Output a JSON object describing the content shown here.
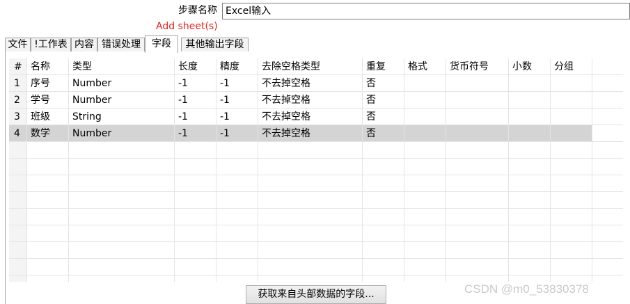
{
  "step": {
    "label": "步骤名称",
    "value": "Excel输入",
    "add_sheet": "Add sheet(s)"
  },
  "tabs": [
    {
      "label": "文件"
    },
    {
      "label": "!工作表"
    },
    {
      "label": "内容"
    },
    {
      "label": "错误处理"
    },
    {
      "label": "字段",
      "active": true
    },
    {
      "label": "其他输出字段"
    }
  ],
  "table": {
    "headers": [
      "#",
      "名称",
      "类型",
      "长度",
      "精度",
      "去除空格类型",
      "重复",
      "格式",
      "货币符号",
      "小数",
      "分组"
    ],
    "rows": [
      [
        "1",
        "序号",
        "Number",
        "-1",
        "-1",
        "不去掉空格",
        "否",
        "",
        "",
        "",
        ""
      ],
      [
        "2",
        "学号",
        "Number",
        "-1",
        "-1",
        "不去掉空格",
        "否",
        "",
        "",
        "",
        ""
      ],
      [
        "3",
        "班级",
        "String",
        "-1",
        "-1",
        "不去掉空格",
        "否",
        "",
        "",
        "",
        ""
      ],
      [
        "4",
        "数学",
        "Number",
        "-1",
        "-1",
        "不去掉空格",
        "否",
        "",
        "",
        "",
        ""
      ]
    ],
    "selected_row": 4
  },
  "buttons": {
    "get_fields": "获取来自头部数据的字段..."
  },
  "watermark": "CSDN @m0_53830378",
  "colors": {
    "accent_red": "#e8231f",
    "selected_row": "#d4d4d4"
  }
}
